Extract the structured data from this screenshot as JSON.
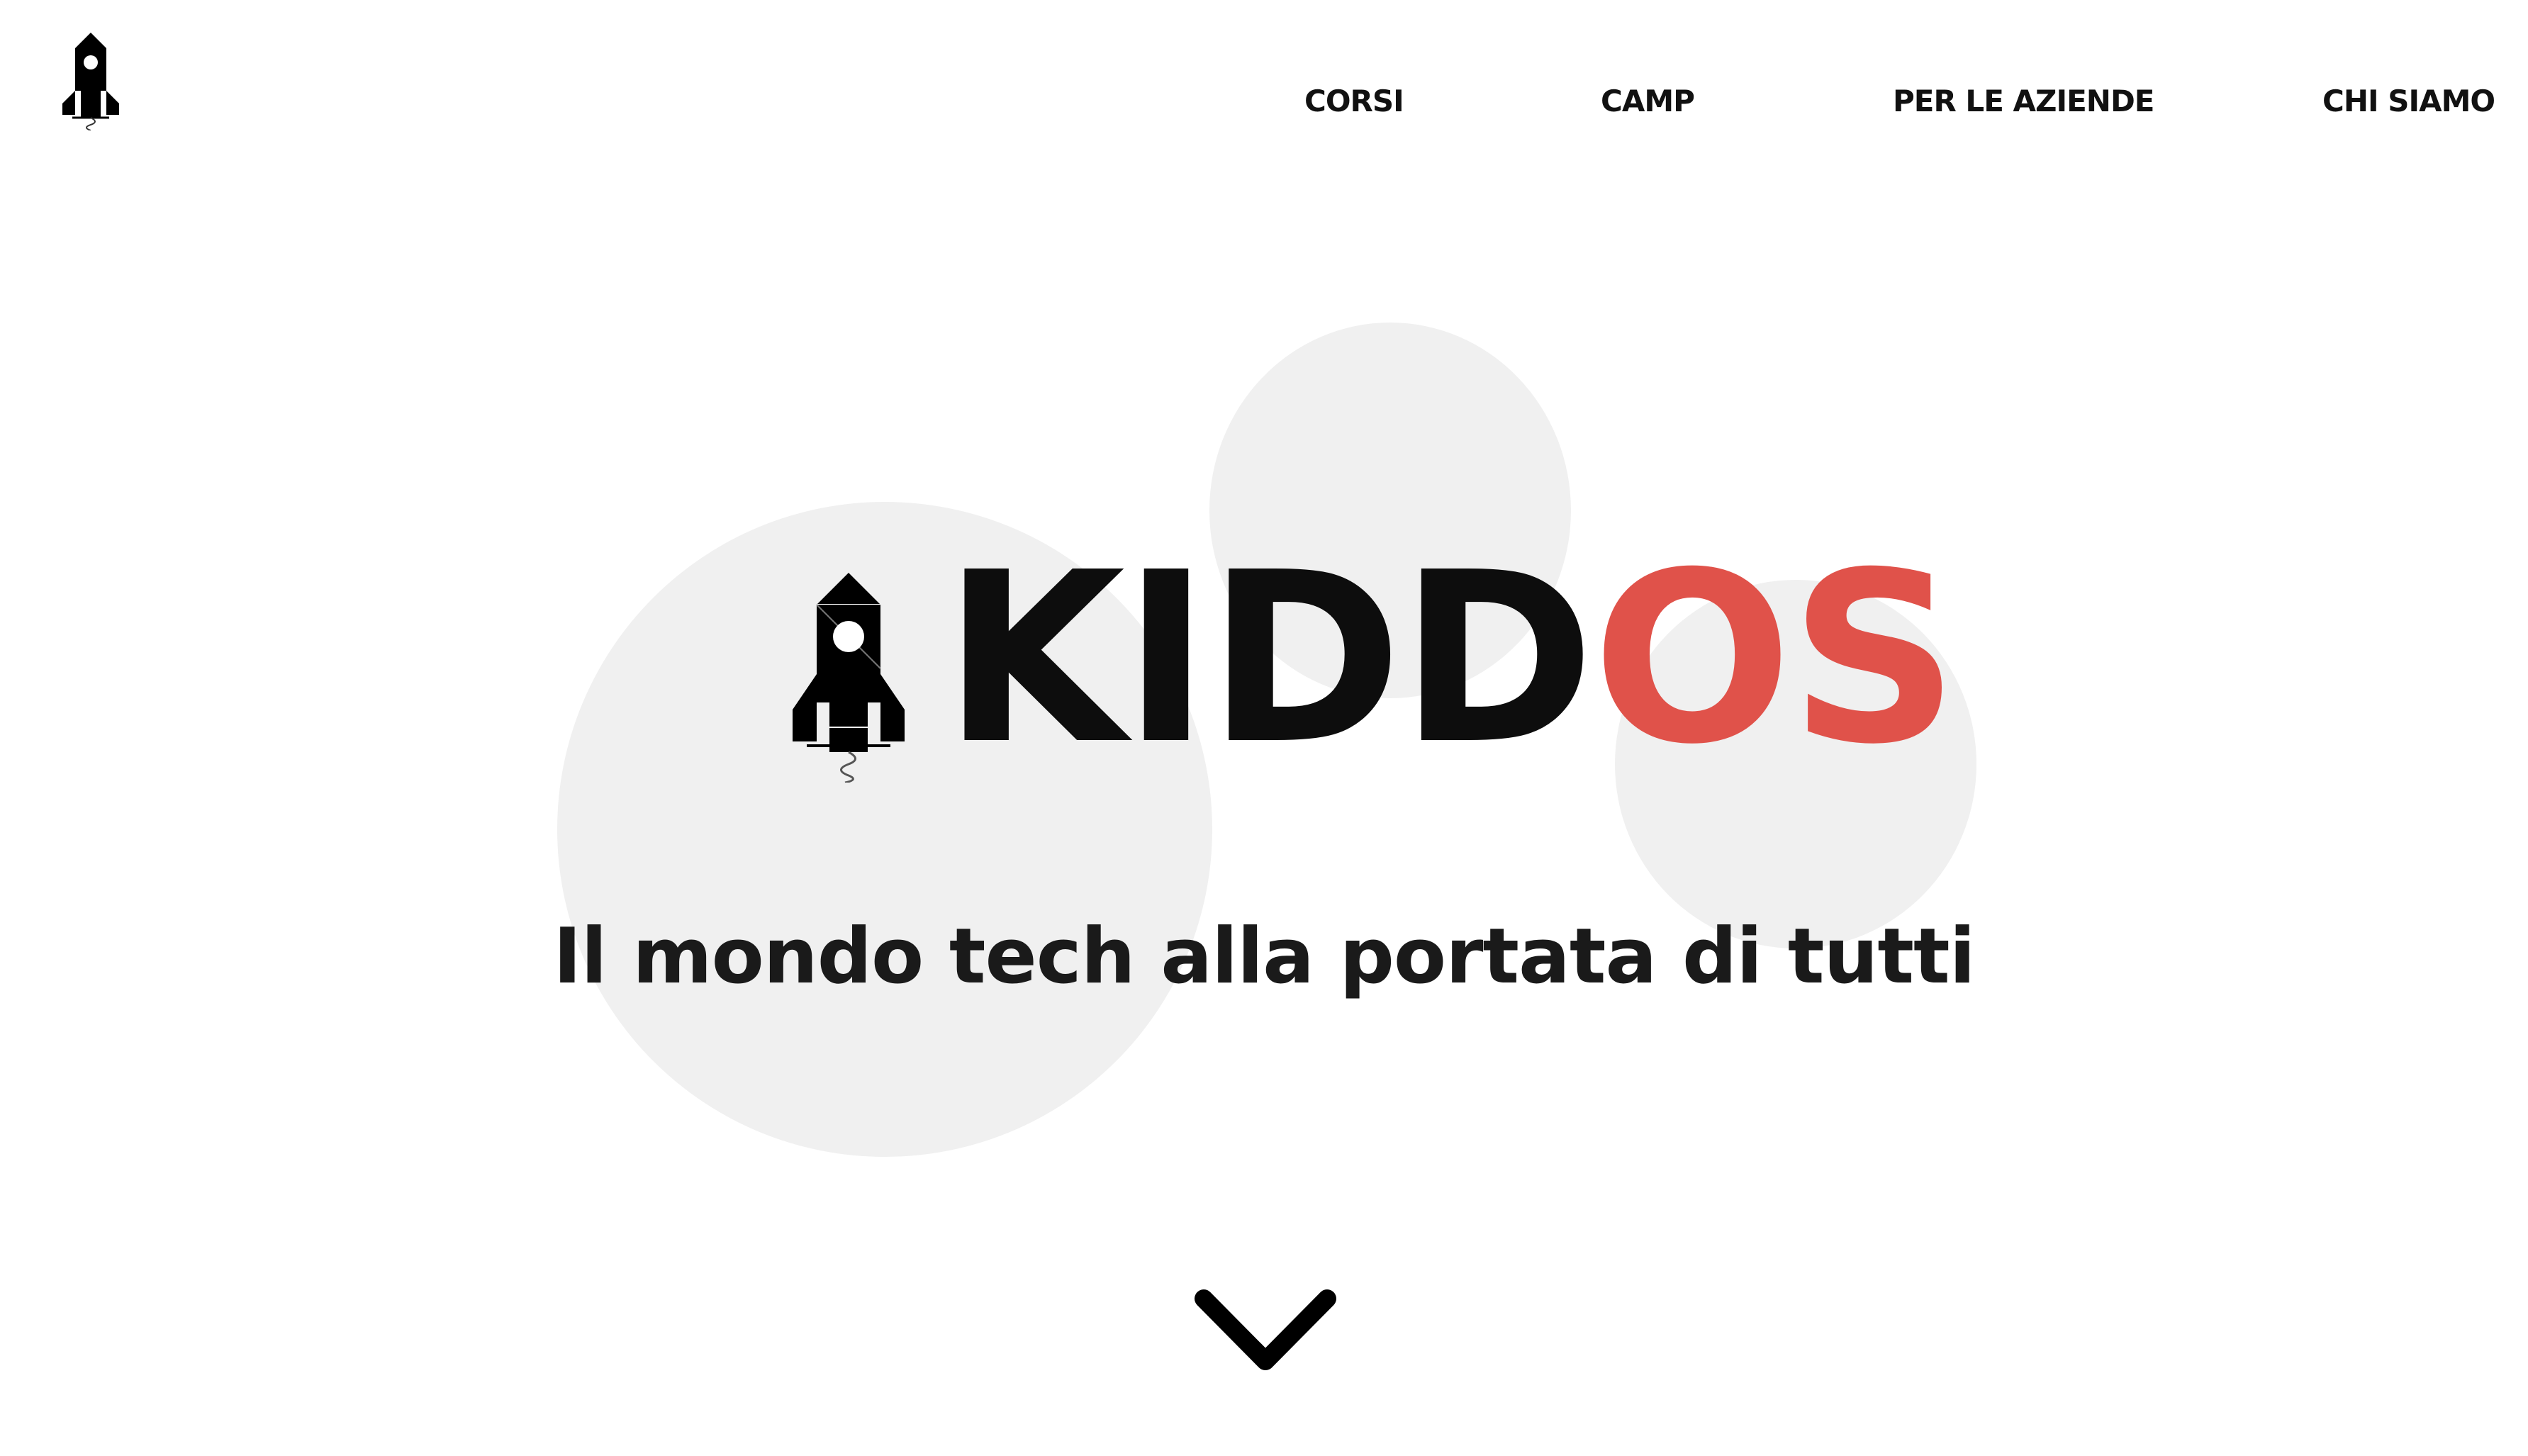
{
  "header": {
    "logo_icon": "rocket-icon"
  },
  "nav": {
    "items": [
      {
        "label": "CORSI"
      },
      {
        "label": "CAMP"
      },
      {
        "label": "PER LE AZIENDE"
      },
      {
        "label": "CHI SIAMO"
      }
    ]
  },
  "hero": {
    "logo_icon": "rocket-icon",
    "brand_part_1": "KIDD",
    "brand_part_2": "OS",
    "tagline": "Il mondo tech alla portata di tutti",
    "scroll_icon": "chevron-down-icon"
  },
  "colors": {
    "accent": "#e0524a",
    "text": "#0d0d0d",
    "circle": "#f0f0f0",
    "background": "#ffffff"
  }
}
